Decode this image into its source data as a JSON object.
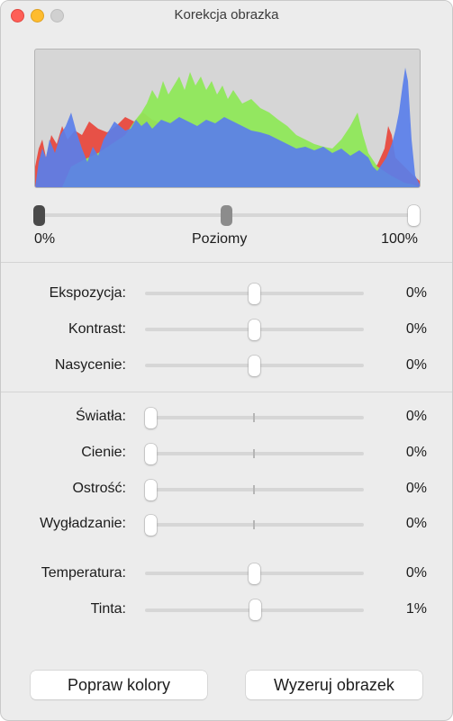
{
  "window": {
    "title": "Korekcja obrazka"
  },
  "levels": {
    "min_label": "0%",
    "label": "Poziomy",
    "max_label": "100%"
  },
  "group1": [
    {
      "label": "Ekspozycja:",
      "value": "0%"
    },
    {
      "label": "Kontrast:",
      "value": "0%"
    },
    {
      "label": "Nasycenie:",
      "value": "0%"
    }
  ],
  "group2": [
    {
      "label": "Światła:",
      "value": "0%"
    },
    {
      "label": "Cienie:",
      "value": "0%"
    },
    {
      "label": "Ostrość:",
      "value": "0%"
    },
    {
      "label": "Wygładzanie:",
      "value": "0%"
    }
  ],
  "group3": [
    {
      "label": "Temperatura:",
      "value": "0%"
    },
    {
      "label": "Tinta:",
      "value": "1%"
    }
  ],
  "buttons": {
    "auto_colors": "Popraw kolory",
    "reset": "Wyzeruj obrazek"
  },
  "colors": {
    "histogram_red": "#e84a3f",
    "histogram_green": "#8fe85a",
    "histogram_blue": "#5a7fea",
    "histogram_bg": "#d6d6d6"
  }
}
